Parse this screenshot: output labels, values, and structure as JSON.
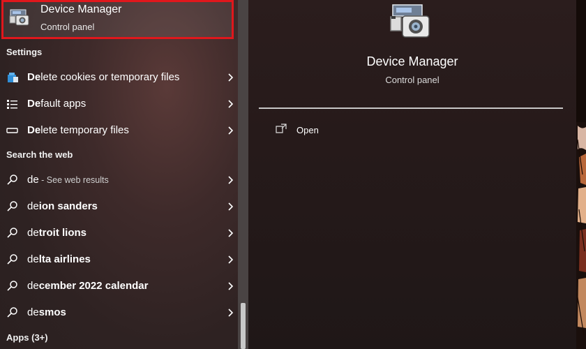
{
  "top_result": {
    "title": "Device Manager",
    "subtitle": "Control panel",
    "icon": "device-manager-icon"
  },
  "settings": {
    "header": "Settings",
    "items": [
      {
        "bold": "De",
        "rest": "lete cookies or temporary files",
        "icon": "cookies-icon"
      },
      {
        "bold": "De",
        "rest": "fault apps",
        "icon": "default-apps-icon"
      },
      {
        "bold": "De",
        "rest": "lete temporary files",
        "icon": "storage-icon"
      }
    ]
  },
  "web": {
    "header": "Search the web",
    "items": [
      {
        "bold": "de",
        "rest": "",
        "extra": " - See web results"
      },
      {
        "bold": "de",
        "rest": "ion sanders",
        "extra": ""
      },
      {
        "bold": "de",
        "rest": "troit lions",
        "extra": ""
      },
      {
        "bold": "de",
        "rest": "lta airlines",
        "extra": ""
      },
      {
        "bold": "de",
        "rest": "cember 2022 calendar",
        "extra": ""
      },
      {
        "bold": "de",
        "rest": "smos",
        "extra": ""
      }
    ]
  },
  "apps": {
    "header": "Apps (3+)"
  },
  "details": {
    "title": "Device Manager",
    "subtitle": "Control panel",
    "open_label": "Open"
  },
  "colors": {
    "highlight_border": "#e0171c"
  }
}
